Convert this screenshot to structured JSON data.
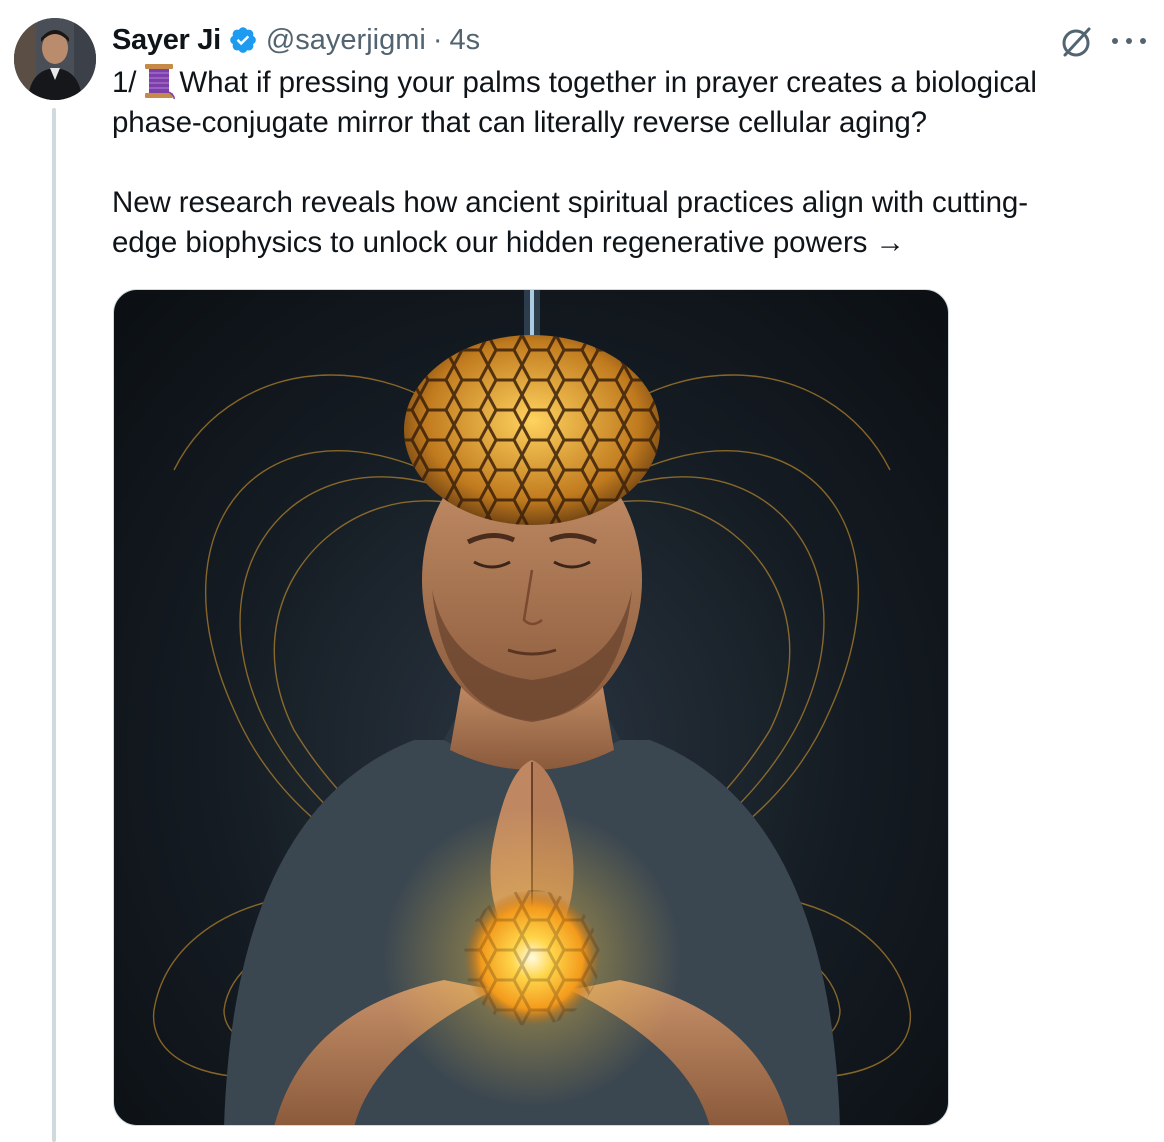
{
  "author": {
    "name": "Sayer Ji",
    "handle": "@sayerjigmi",
    "separator": "·",
    "time": "4s",
    "verified": true
  },
  "tweet": {
    "line1_prefix": "1/",
    "line1_icon": "thread-spool-emoji",
    "line1_rest": "What if pressing your palms together in prayer creates a biological",
    "line2": "phase-conjugate mirror that can literally reverse cellular aging?",
    "line3": "New research reveals how ancient spiritual practices align with cutting-",
    "line4": "edge biophysics to unlock our hidden regenerative powers →"
  },
  "icons": {
    "grok": "grok-icon",
    "more": "more-options-icon",
    "verified": "verified-badge-icon"
  },
  "colors": {
    "text": "#0f1419",
    "secondary": "#536471",
    "verified": "#1d9bf0",
    "thread_line": "#cfd9de",
    "glow": "#f7b733"
  }
}
